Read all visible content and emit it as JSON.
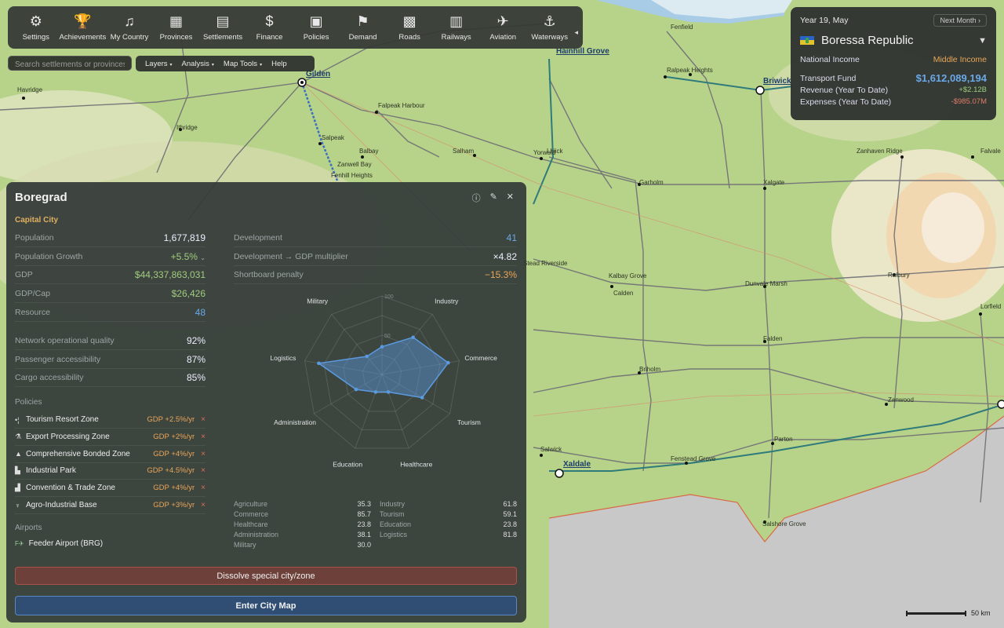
{
  "toolbar": {
    "items": [
      {
        "label": "Settings",
        "icon": "gear-icon",
        "glyph": "⚙"
      },
      {
        "label": "Achievements",
        "icon": "trophy-icon",
        "glyph": "🏆"
      },
      {
        "label": "My Country",
        "icon": "country-icon",
        "glyph": "♫"
      },
      {
        "label": "Provinces",
        "icon": "provinces-icon",
        "glyph": "▦"
      },
      {
        "label": "Settlements",
        "icon": "settlements-icon",
        "glyph": "▤"
      },
      {
        "label": "Finance",
        "icon": "finance-icon",
        "glyph": "$"
      },
      {
        "label": "Policies",
        "icon": "policies-icon",
        "glyph": "▣"
      },
      {
        "label": "Demand",
        "icon": "demand-icon",
        "glyph": "⚑"
      },
      {
        "label": "Roads",
        "icon": "roads-icon",
        "glyph": "▩"
      },
      {
        "label": "Railways",
        "icon": "railways-icon",
        "glyph": "▥"
      },
      {
        "label": "Aviation",
        "icon": "aviation-icon",
        "glyph": "✈"
      },
      {
        "label": "Waterways",
        "icon": "waterways-icon",
        "glyph": "⚓"
      }
    ],
    "collapse": "◂"
  },
  "search": {
    "placeholder": "Search settlements or provinces"
  },
  "menus": {
    "layers": "Layers",
    "analysis": "Analysis",
    "map_tools": "Map Tools",
    "help": "Help",
    "caret": "▾"
  },
  "nation": {
    "date": "Year 19, May",
    "next_month": "Next Month ›",
    "country": "Boressa Republic",
    "national_income_label": "National Income",
    "national_income": "Middle Income",
    "transport_fund_label": "Transport Fund",
    "transport_fund": "$1,612,089,194",
    "revenue_label": "Revenue (Year To Date)",
    "revenue": "+$2.12B",
    "expenses_label": "Expenses (Year To Date)",
    "expenses": "-$985.07M"
  },
  "city": {
    "name": "Boregrad",
    "type": "Capital City",
    "population_label": "Population",
    "population": "1,677,819",
    "growth_label": "Population Growth",
    "growth": "+5.5%",
    "gdp_label": "GDP",
    "gdp": "$44,337,863,031",
    "gdpcap_label": "GDP/Cap",
    "gdpcap": "$26,426",
    "resource_label": "Resource",
    "resource": "48",
    "network_label": "Network operational quality",
    "network": "92%",
    "passenger_label": "Passenger accessibility",
    "passenger": "87%",
    "cargo_label": "Cargo accessibility",
    "cargo": "85%",
    "development_label": "Development",
    "development": "41",
    "multiplier_label": "Development → GDP multiplier",
    "multiplier": "×4.82",
    "shortboard_label": "Shortboard penalty",
    "shortboard": "−15.3%",
    "policies_label": "Policies",
    "policies": [
      {
        "name": "Tourism Resort Zone",
        "gdp": "GDP +2.5%/yr",
        "icon": "tourism-icon",
        "glyph": "•¦"
      },
      {
        "name": "Export Processing Zone",
        "gdp": "GDP +2%/yr",
        "icon": "export-icon",
        "glyph": "⚗"
      },
      {
        "name": "Comprehensive Bonded Zone",
        "gdp": "GDP +4%/yr",
        "icon": "bonded-icon",
        "glyph": "▲"
      },
      {
        "name": "Industrial Park",
        "gdp": "GDP +4.5%/yr",
        "icon": "factory-icon",
        "glyph": "▙"
      },
      {
        "name": "Convention & Trade Zone",
        "gdp": "GDP +4%/yr",
        "icon": "convention-icon",
        "glyph": "▟"
      },
      {
        "name": "Agro-Industrial Base",
        "gdp": "GDP +3%/yr",
        "icon": "agro-icon",
        "glyph": "♆"
      }
    ],
    "remove_glyph": "×",
    "airports_label": "Airports",
    "airport": "Feeder Airport (BRG)",
    "airport_glyph": "F✈",
    "dissolve": "Dissolve special city/zone",
    "enter": "Enter City Map"
  },
  "chart_data": {
    "type": "radar",
    "categories": [
      "Agriculture",
      "Industry",
      "Commerce",
      "Tourism",
      "Healthcare",
      "Education",
      "Administration",
      "Logistics",
      "Military"
    ],
    "values": [
      35.3,
      61.8,
      85.7,
      59.1,
      23.8,
      23.8,
      38.1,
      81.8,
      30.0
    ],
    "rings": [
      50,
      100
    ],
    "ylim": [
      0,
      100
    ],
    "color": "#5a9ae0"
  },
  "table": {
    "rows": [
      {
        "k": "Agriculture",
        "v": "35.3"
      },
      {
        "k": "Industry",
        "v": "61.8"
      },
      {
        "k": "Commerce",
        "v": "85.7"
      },
      {
        "k": "Tourism",
        "v": "59.1"
      },
      {
        "k": "Healthcare",
        "v": "23.8"
      },
      {
        "k": "Education",
        "v": "23.8"
      },
      {
        "k": "Administration",
        "v": "38.1"
      },
      {
        "k": "Logistics",
        "v": "81.8"
      },
      {
        "k": "Military",
        "v": "30.0"
      }
    ]
  },
  "map": {
    "labels": [
      "Havridge",
      "Ithridge",
      "Gilden",
      "Salpeak",
      "Balbay",
      "Zanwell Bay",
      "Fenhill Heights",
      "Falpeak Harbour",
      "Salham",
      "Yorwold",
      "Lhiick",
      "Hainhill Grove",
      "Fenfield",
      "Ralpeak Heights",
      "Briwick",
      "Garholm",
      "Xalgate",
      "Zanhaven Ridge",
      "Falvale",
      "Stead Riverside",
      "Kalbay Grove",
      "Calden",
      "Dunvale Marsh",
      "Ralbury",
      "Lorfield",
      "Falden",
      "Briholm",
      "Zanwood",
      "Parton",
      "Salwick",
      "Xaldale",
      "Fenstead Grove",
      "Salshore Grove"
    ],
    "scale": "50 km"
  }
}
